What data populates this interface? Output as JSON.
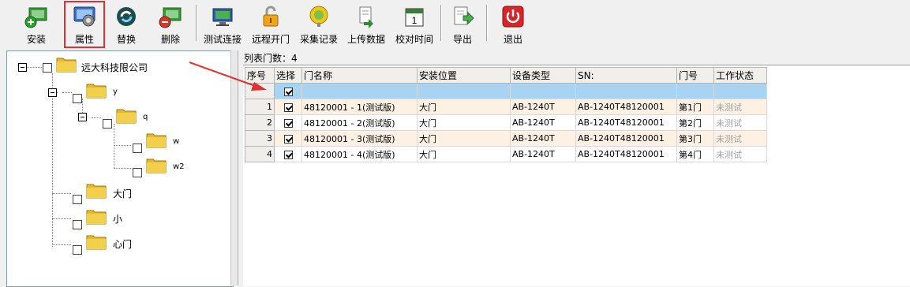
{
  "toolbar": {
    "buttons": [
      {
        "label": "安装",
        "icon": "install-icon"
      },
      {
        "label": "属性",
        "icon": "properties-icon",
        "selected": true
      },
      {
        "label": "替换",
        "icon": "replace-icon"
      },
      {
        "label": "删除",
        "icon": "delete-icon"
      },
      {
        "label": "测试连接",
        "icon": "test-connection-icon"
      },
      {
        "label": "远程开门",
        "icon": "remote-unlock-icon"
      },
      {
        "label": "采集记录",
        "icon": "collect-records-icon"
      },
      {
        "label": "上传数据",
        "icon": "upload-data-icon"
      },
      {
        "label": "校对时间",
        "icon": "calendar-icon"
      },
      {
        "label": "导出",
        "icon": "export-icon"
      },
      {
        "label": "退出",
        "icon": "power-icon"
      }
    ],
    "calendar_day": "1"
  },
  "tree": {
    "root": "远大科技限公司",
    "n_y": "y",
    "n_q": "q",
    "n_w": "w",
    "n_w2": "w2",
    "n_damen": "大门",
    "n_xiao": "小",
    "n_xinmen": "心门"
  },
  "grid": {
    "count_label": "列表门数：4",
    "headers": [
      "序号",
      "选择",
      "门名称",
      "安装位置",
      "设备类型",
      "SN:",
      "门号",
      "工作状态"
    ],
    "rows": [
      {
        "num": "1",
        "checked": true,
        "name": "48120001 - 1(测试版)",
        "location": "大门",
        "type": "AB-1240T",
        "sn": "AB-1240T48120001",
        "door": "第1门",
        "status": "未测试"
      },
      {
        "num": "2",
        "checked": true,
        "name": "48120001 - 2(测试版)",
        "location": "大门",
        "type": "AB-1240T",
        "sn": "AB-1240T48120001",
        "door": "第2门",
        "status": "未测试"
      },
      {
        "num": "3",
        "checked": true,
        "name": "48120001 - 3(测试版)",
        "location": "大门",
        "type": "AB-1240T",
        "sn": "AB-1240T48120001",
        "door": "第3门",
        "status": "未测试"
      },
      {
        "num": "4",
        "checked": true,
        "name": "48120001 - 4(测试版)",
        "location": "大门",
        "type": "AB-1240T",
        "sn": "AB-1240T48120001",
        "door": "第4门",
        "status": "未测试"
      }
    ]
  },
  "colors": {
    "selection_outline": "#e03030",
    "filter_row": "#a6d4f2",
    "odd_row": "#fdf1e3",
    "arrow": "#e03030",
    "status_text": "#a0a0a0"
  }
}
